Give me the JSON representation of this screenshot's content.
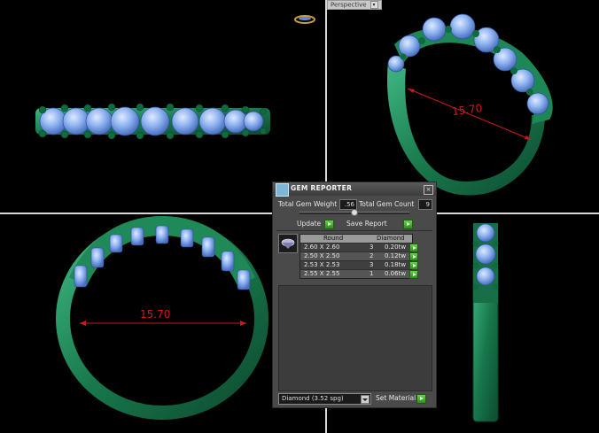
{
  "viewport": {
    "perspective_label": "Perspective",
    "dimension_side": "15.70",
    "dimension_front": "15.70"
  },
  "gem_reporter": {
    "title": "GEM REPORTER",
    "close_icon": "close-icon",
    "total_gem_weight_label": "Total Gem Weight",
    "total_gem_weight_value": ".56",
    "total_gem_count_label": "Total Gem Count",
    "total_gem_count_value": "9",
    "update_label": "Update",
    "save_report_label": "Save Report",
    "table": {
      "headers": [
        "Round",
        "Diamond"
      ],
      "rows": [
        {
          "size": "2.60 X 2.60",
          "count": "3",
          "weight": "0.20tw"
        },
        {
          "size": "2.50 X 2.50",
          "count": "2",
          "weight": "0.12tw"
        },
        {
          "size": "2.53 X 2.53",
          "count": "3",
          "weight": "0.18tw"
        },
        {
          "size": "2.55 X 2.55",
          "count": "1",
          "weight": "0.06tw"
        }
      ]
    },
    "material_select": "Diamond    (3.52 spg)",
    "set_material_label": "Set Material"
  },
  "colors": {
    "metal": "#1e8a5a",
    "gem": "#8cb6f0",
    "dimension": "#d01818"
  }
}
